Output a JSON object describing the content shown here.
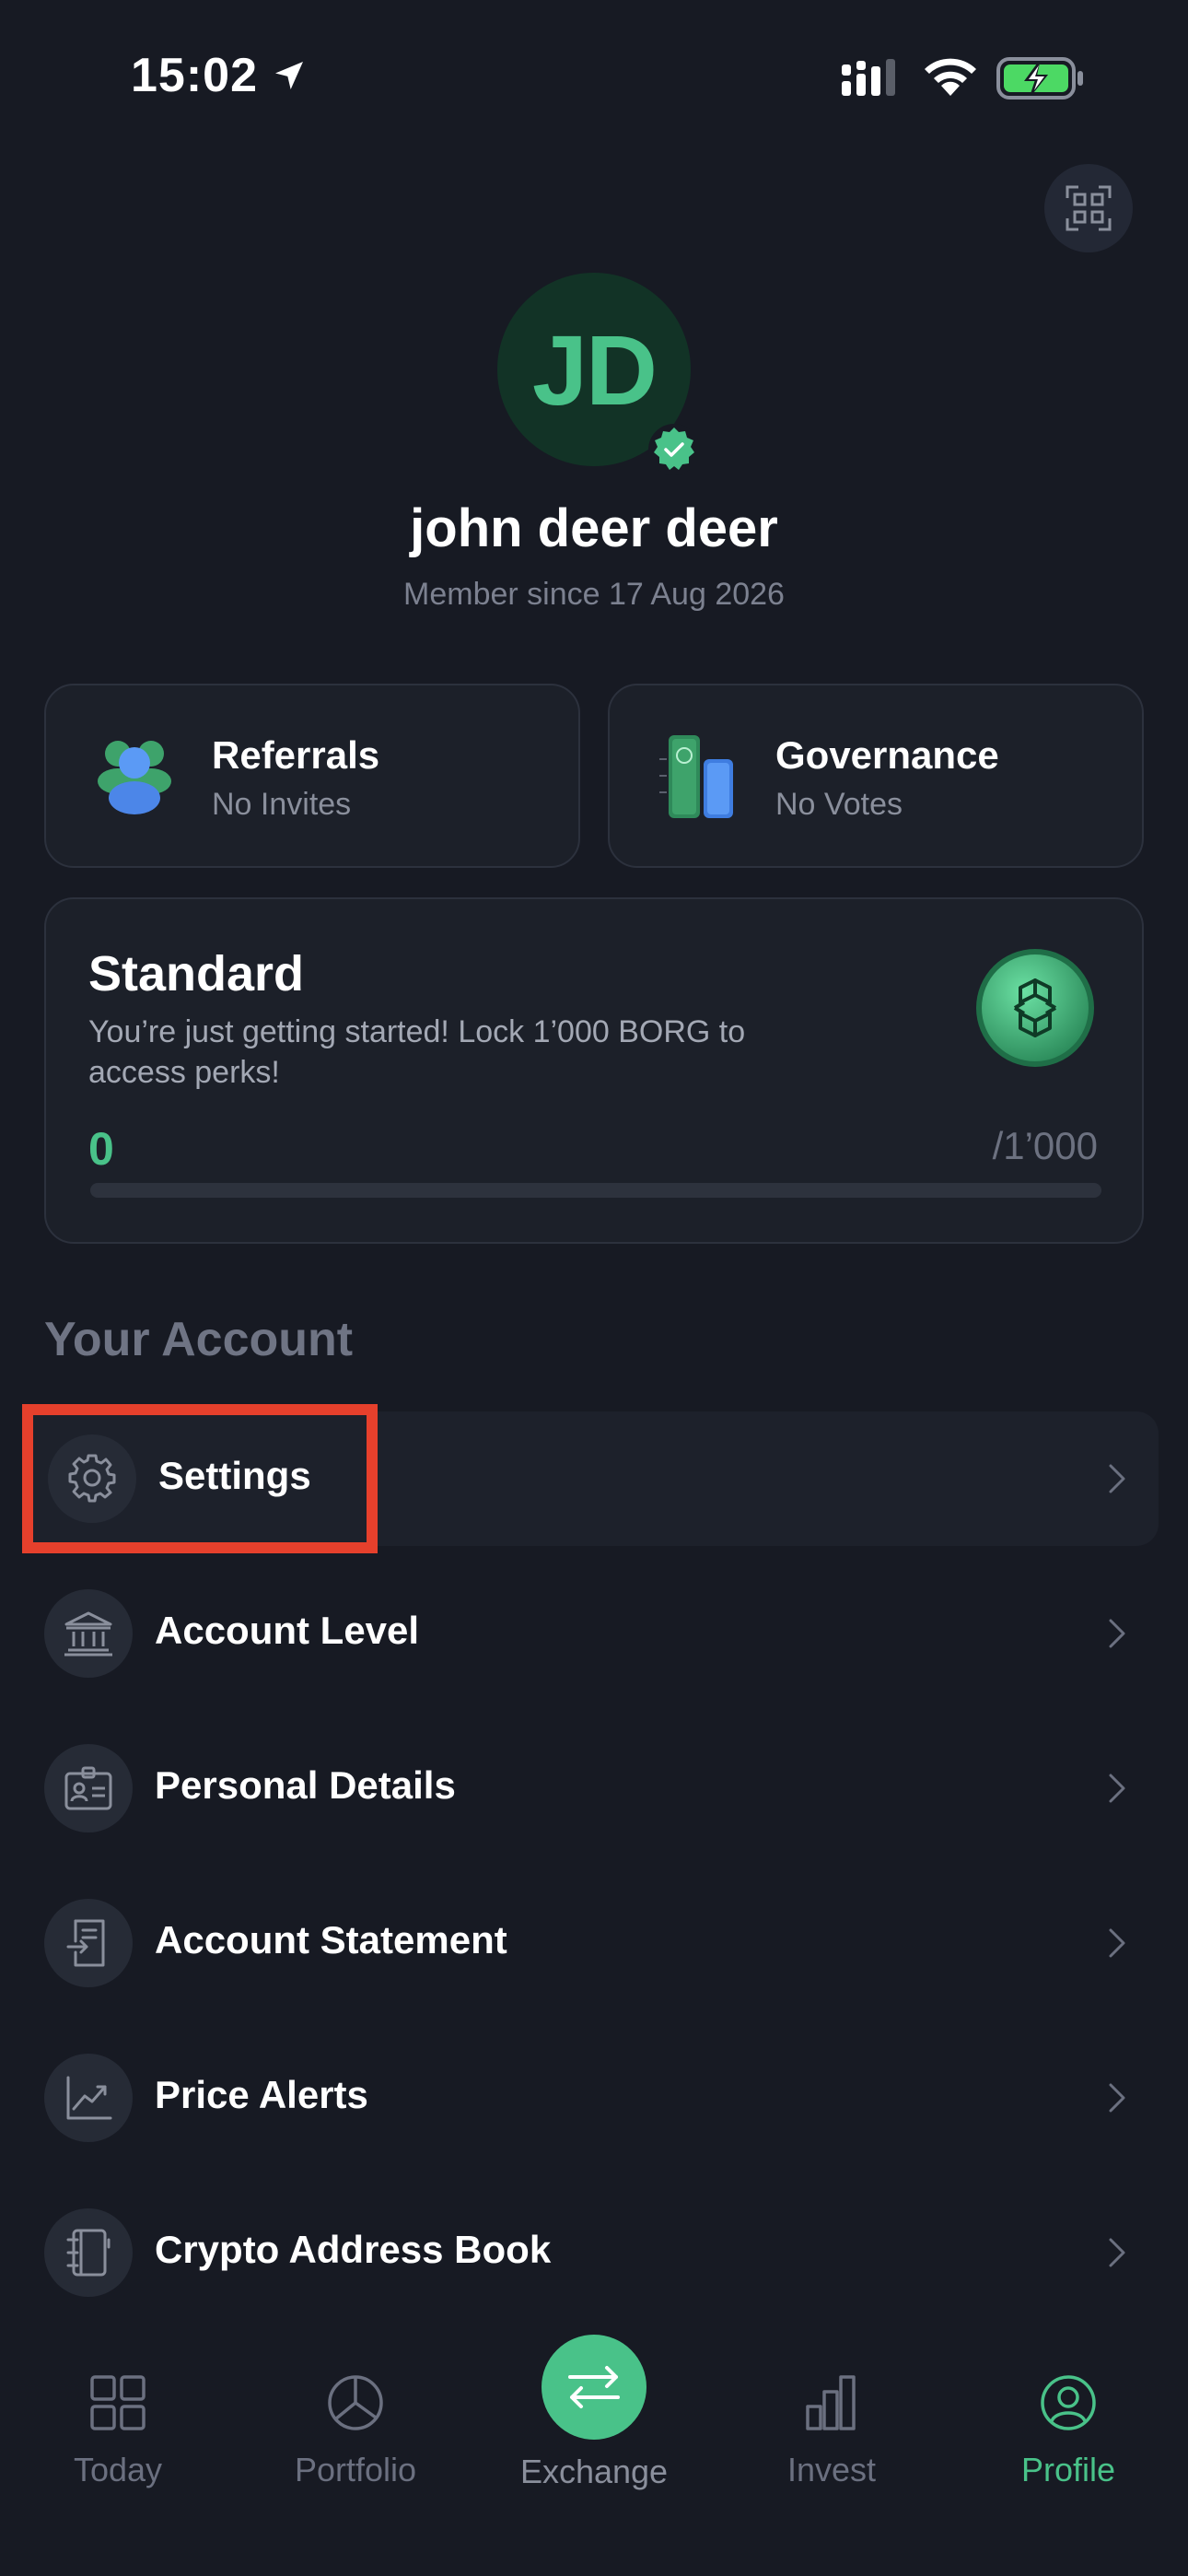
{
  "status_bar": {
    "time": "15:02"
  },
  "profile": {
    "initials": "JD",
    "name": "john deer deer",
    "member_since": "Member since 17 Aug 2026",
    "accent_color": "#49c289"
  },
  "cards": {
    "referrals": {
      "title": "Referrals",
      "subtitle": "No Invites"
    },
    "governance": {
      "title": "Governance",
      "subtitle": "No Votes"
    }
  },
  "tier": {
    "title": "Standard",
    "description": "You’re just getting started! Lock 1’000 BORG to access perks!",
    "progress_value": "0",
    "progress_target": "/1’000",
    "progress_fraction": 0
  },
  "account": {
    "section_title": "Your Account",
    "items": [
      {
        "label": "Settings",
        "icon": "gear-icon"
      },
      {
        "label": "Account Level",
        "icon": "bank-icon"
      },
      {
        "label": "Personal Details",
        "icon": "id-card-icon"
      },
      {
        "label": "Account Statement",
        "icon": "document-icon"
      },
      {
        "label": "Price Alerts",
        "icon": "chart-icon"
      },
      {
        "label": "Crypto Address Book",
        "icon": "address-book-icon"
      }
    ]
  },
  "tabs": [
    {
      "label": "Today",
      "icon": "grid-icon"
    },
    {
      "label": "Portfolio",
      "icon": "pie-chart-icon"
    },
    {
      "label": "Exchange",
      "icon": "swap-icon"
    },
    {
      "label": "Invest",
      "icon": "bar-chart-icon"
    },
    {
      "label": "Profile",
      "icon": "user-icon",
      "active": true
    }
  ]
}
